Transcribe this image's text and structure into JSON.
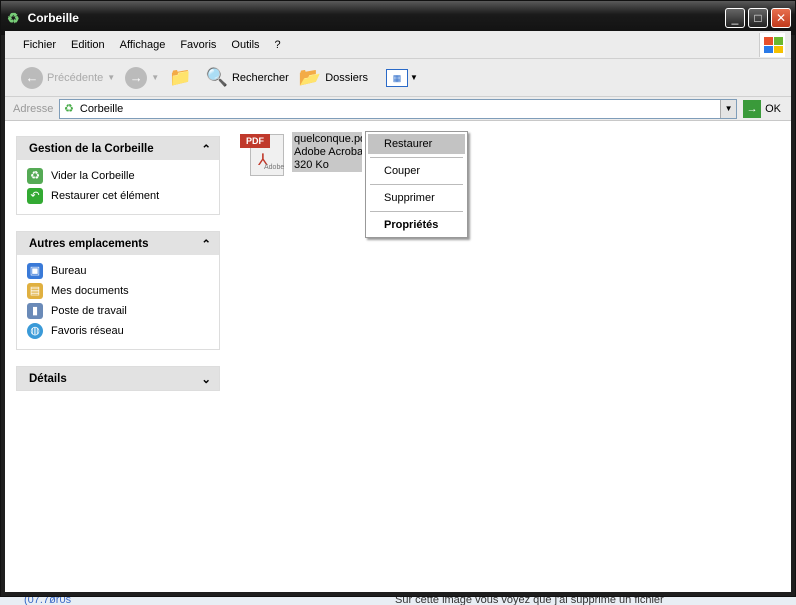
{
  "window": {
    "title": "Corbeille"
  },
  "menu": [
    "Fichier",
    "Edition",
    "Affichage",
    "Favoris",
    "Outils",
    "?"
  ],
  "toolbar": {
    "back": "Précédente",
    "search": "Rechercher",
    "folders": "Dossiers"
  },
  "address": {
    "label": "Adresse",
    "value": "Corbeille",
    "go": "OK"
  },
  "panels": [
    {
      "title": "Gestion de la Corbeille",
      "items": [
        "Vider la Corbeille",
        "Restaurer cet élément"
      ]
    },
    {
      "title": "Autres emplacements",
      "items": [
        "Bureau",
        "Mes documents",
        "Poste de travail",
        "Favoris réseau"
      ]
    },
    {
      "title": "Détails",
      "items": []
    }
  ],
  "file": {
    "name": "quelconque.pdf",
    "type": "Adobe Acrobat",
    "size": "320 Ko",
    "badge": "PDF",
    "logo": "Adobe"
  },
  "context_menu": [
    "Restaurer",
    "Couper",
    "Supprimer",
    "Propriétés"
  ],
  "background_text": {
    "left": "(07.7ør0s",
    "caption": "Sur cette image vous voyez que j'ai supprimé un fichier"
  },
  "colors": {
    "selection": "#c8c8c8",
    "panel_header": "#e2e2e2"
  }
}
